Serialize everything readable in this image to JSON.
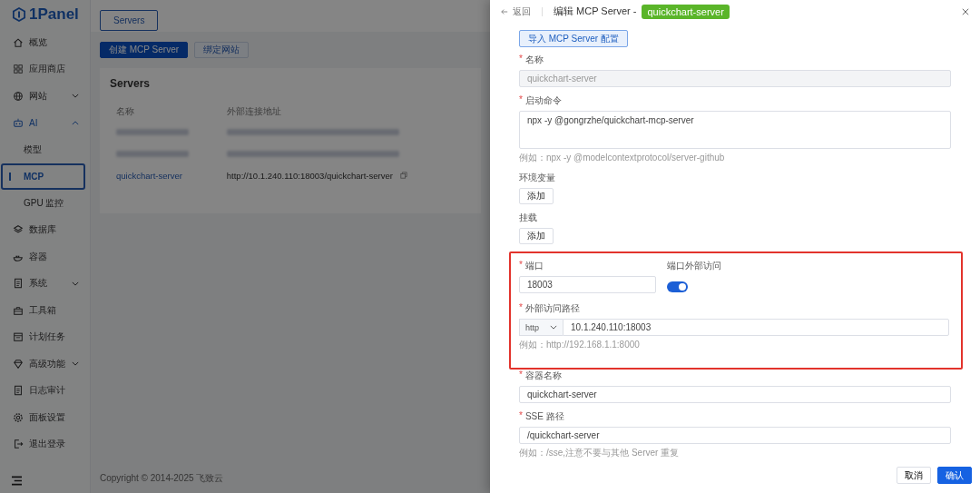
{
  "sidebar": {
    "logo": "1Panel",
    "items": [
      {
        "kind": "item",
        "label": "概览",
        "selected": false
      },
      {
        "kind": "item",
        "label": "应用商店",
        "selected": false
      },
      {
        "kind": "group",
        "label": "网站",
        "expanded": false
      },
      {
        "kind": "group",
        "label": "AI",
        "expanded": true,
        "children": [
          {
            "label": "模型",
            "selected": false
          },
          {
            "label": "MCP",
            "selected": true
          },
          {
            "label": "GPU 监控",
            "selected": false
          }
        ]
      },
      {
        "kind": "item",
        "label": "数据库",
        "selected": false
      },
      {
        "kind": "item",
        "label": "容器",
        "selected": false
      },
      {
        "kind": "group",
        "label": "系统",
        "expanded": false
      },
      {
        "kind": "item",
        "label": "工具箱",
        "selected": false
      },
      {
        "kind": "item",
        "label": "计划任务",
        "selected": false
      },
      {
        "kind": "group",
        "label": "高级功能",
        "expanded": false
      },
      {
        "kind": "item",
        "label": "日志审计",
        "selected": false
      },
      {
        "kind": "item",
        "label": "面板设置",
        "selected": false
      },
      {
        "kind": "item",
        "label": "退出登录",
        "selected": false
      }
    ]
  },
  "main": {
    "tabs": [
      {
        "label": "Servers",
        "selected": true
      }
    ],
    "buttons": [
      {
        "label": "创建 MCP Server",
        "kind": "primary"
      },
      {
        "label": "绑定网站",
        "kind": "plain"
      }
    ],
    "card": {
      "title": "Servers",
      "columns": [
        "名称",
        "外部连接地址"
      ],
      "rows": [
        {
          "redacted": true
        },
        {
          "redacted": true
        },
        {
          "redacted": false,
          "name": "quickchart-server",
          "url": "http://10.1.240.110:18003/quickchart-server"
        }
      ]
    },
    "footer": "Copyright © 2014-2025 飞致云"
  },
  "drawer": {
    "back": "返回",
    "title": "编辑 MCP Server -",
    "tag": "quickchart-server",
    "import_button": "导入 MCP Server 配置",
    "fields": [
      {
        "kind": "input",
        "marker": "*",
        "label": "名称",
        "value": "quickchart-server",
        "disabled": true,
        "highlighted": false
      },
      {
        "kind": "textarea",
        "marker": "*",
        "label": "启动命令",
        "value": "npx -y @gongrzhe/quickchart-mcp-server",
        "hint": "例如：npx -y @modelcontextprotocol/server-github",
        "highlighted": false
      },
      {
        "kind": "add",
        "label": "环境变量",
        "button": "添加",
        "highlighted": false
      },
      {
        "kind": "add",
        "label": "挂载",
        "button": "添加",
        "highlighted": false
      },
      {
        "kind": "port",
        "marker": "*",
        "label": "端口",
        "value": "18003",
        "toggle_label": "端口外部访问",
        "toggle_on": true,
        "highlighted": true
      },
      {
        "kind": "url",
        "marker": "*",
        "label": "外部访问路径",
        "scheme": "http",
        "value": "10.1.240.110:18003",
        "hint": "例如：http://192.168.1.1:8000",
        "highlighted": true
      },
      {
        "kind": "input",
        "marker": "*",
        "label": "容器名称",
        "value": "quickchart-server",
        "disabled": false,
        "highlighted": false
      },
      {
        "kind": "input",
        "marker": "*",
        "label": "SSE 路径",
        "value": "/quickchart-server",
        "disabled": false,
        "hint": "例如：/sse,注意不要与其他 Server 重复",
        "highlighted": false
      }
    ],
    "cancel": "取消",
    "confirm": "确认"
  }
}
